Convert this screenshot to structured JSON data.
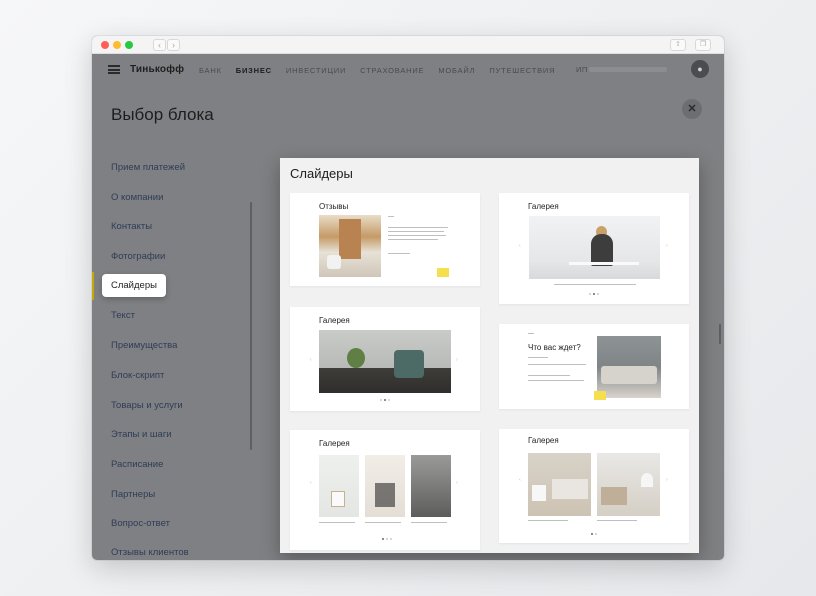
{
  "header": {
    "brand": "Тинькофф",
    "nav": [
      "БАНК",
      "БИЗНЕС",
      "ИНВЕСТИЦИИ",
      "СТРАХОВАНИЕ",
      "МОБАЙЛ",
      "ПУТЕШЕСТВИЯ"
    ],
    "active_nav": "БИЗНЕС",
    "account_prefix": "ИП"
  },
  "modal": {
    "title": "Выбор блока",
    "close_icon": "close-icon"
  },
  "sidebar": {
    "items": [
      "Прием платежей",
      "О компании",
      "Контакты",
      "Фотографии",
      "Слайдеры",
      "Текст",
      "Преимущества",
      "Блок-скрипт",
      "Товары и услуги",
      "Этапы и шаги",
      "Расписание",
      "Партнеры",
      "Вопрос-ответ",
      "Отзывы клиентов"
    ],
    "selected": "Слайдеры",
    "accent": "#c6a900"
  },
  "panel": {
    "title": "Слайдеры",
    "cards": [
      {
        "title": "Отзывы",
        "heading": ""
      },
      {
        "title": "Галерея",
        "heading": ""
      },
      {
        "title": "Галерея",
        "heading": ""
      },
      {
        "title": "",
        "heading": "Что вас ждет?"
      },
      {
        "title": "Галерея",
        "heading": ""
      },
      {
        "title": "Галерея",
        "heading": ""
      }
    ]
  }
}
